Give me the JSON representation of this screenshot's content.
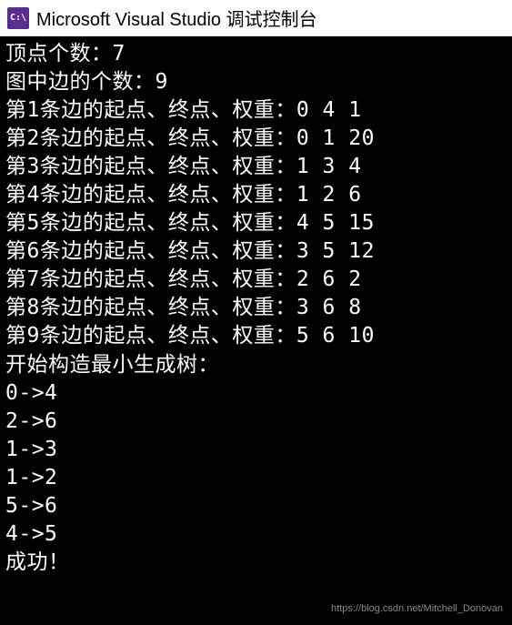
{
  "window": {
    "icon_label": "C:\\",
    "title": "Microsoft Visual Studio 调试控制台"
  },
  "console": {
    "lines": [
      "顶点个数：7",
      "图中边的个数：9",
      "第1条边的起点、终点、权重：0 4 1",
      "第2条边的起点、终点、权重：0 1 20",
      "第3条边的起点、终点、权重：1 3 4",
      "第4条边的起点、终点、权重：1 2 6",
      "第5条边的起点、终点、权重：4 5 15",
      "第6条边的起点、终点、权重：3 5 12",
      "第7条边的起点、终点、权重：2 6 2",
      "第8条边的起点、终点、权重：3 6 8",
      "第9条边的起点、终点、权重：5 6 10",
      "开始构造最小生成树：",
      "0->4",
      "2->6",
      "1->3",
      "1->2",
      "5->6",
      "4->5",
      "成功！"
    ]
  },
  "watermark": "https://blog.csdn.net/Mitchell_Donovan"
}
